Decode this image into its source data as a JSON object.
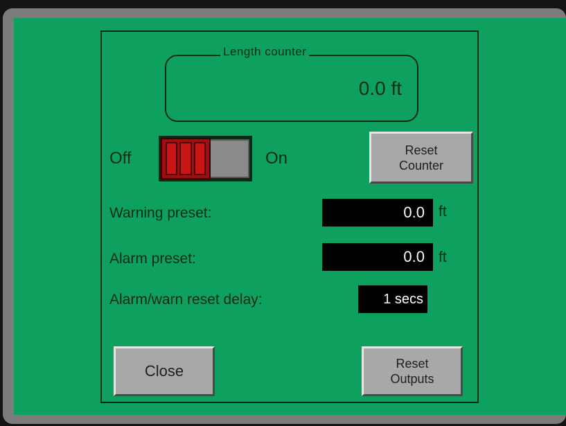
{
  "counter": {
    "title": "Length counter",
    "value": "0.0 ft"
  },
  "toggle": {
    "off_label": "Off",
    "on_label": "On",
    "state": "off"
  },
  "buttons": {
    "reset_counter": [
      "Reset",
      "Counter"
    ],
    "close": "Close",
    "reset_outputs": [
      "Reset",
      "Outputs"
    ]
  },
  "presets": {
    "warning_label": "Warning preset:",
    "warning_value": "0.0",
    "warning_unit": "ft",
    "alarm_label": "Alarm preset:",
    "alarm_value": "0.0",
    "alarm_unit": "ft",
    "delay_label": "Alarm/warn reset delay:",
    "delay_value": "1 secs"
  },
  "colors": {
    "screen": "#0ea05e",
    "frame": "#7c7c7c",
    "switch_knob": "#c81616"
  }
}
